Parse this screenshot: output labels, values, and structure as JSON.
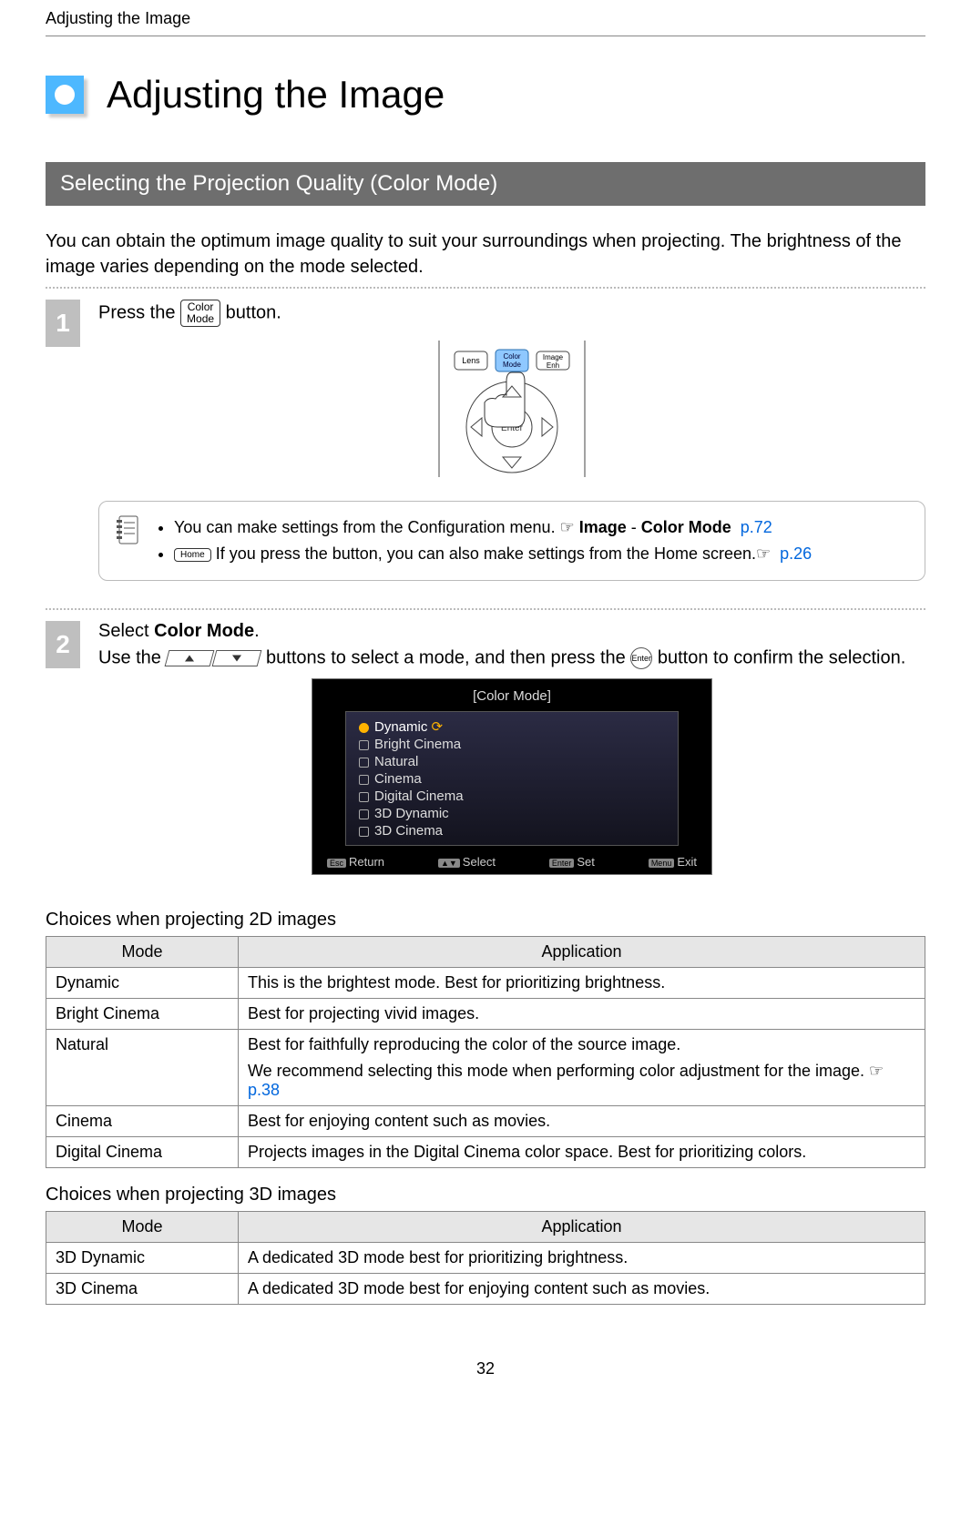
{
  "running_head": "Adjusting the Image",
  "title": "Adjusting the Image",
  "section_bar": "Selecting the Projection Quality (Color Mode)",
  "intro": "You can obtain the optimum image quality to suit your surroundings when projecting. The brightness of the image varies depending on the mode selected.",
  "step1": {
    "num": "1",
    "text_before": "Press the ",
    "btn": "Color\nMode",
    "text_after": " button."
  },
  "remote_labels": {
    "lens": "Lens",
    "color": "Color\nMode",
    "enh": "Image\nEnh",
    "enter": "Enter"
  },
  "note": {
    "line1_a": "You can make settings from the Configuration menu. ",
    "line1_b": "Image",
    "line1_c": " - ",
    "line1_d": "Color Mode",
    "line1_link": "p.72",
    "line2_btn": "Home",
    "line2_a": " If you press the button, you can also make settings from the Home screen.",
    "line2_link": "p.26"
  },
  "step2": {
    "num": "2",
    "title_a": "Select ",
    "title_b": "Color Mode",
    "title_c": ".",
    "body_a": "Use the ",
    "body_b": " buttons to select a mode, and then press the ",
    "enter": "Enter",
    "body_c": " button to confirm the selection."
  },
  "menushot": {
    "title": "[Color Mode]",
    "items": [
      "Dynamic",
      "Bright Cinema",
      "Natural",
      "Cinema",
      "Digital Cinema",
      "3D Dynamic",
      "3D Cinema"
    ],
    "selected_index": 0,
    "foot": {
      "return_k": "Esc",
      "return": "Return",
      "select_k": "▲▼",
      "select": "Select",
      "set_k": "Enter",
      "set": "Set",
      "exit_k": "Menu",
      "exit": "Exit"
    }
  },
  "table2d_caption": "Choices when projecting 2D images",
  "table_headers": {
    "mode": "Mode",
    "app": "Application"
  },
  "table2d": [
    {
      "mode": "Dynamic",
      "app": "This is the brightest mode. Best for prioritizing brightness."
    },
    {
      "mode": "Bright Cinema",
      "app": "Best for projecting vivid images."
    },
    {
      "mode": "Natural",
      "app_a": "Best for faithfully reproducing the color of the source image.",
      "app_b": "We recommend selecting this mode when performing color adjustment for the image.",
      "link": "p.38"
    },
    {
      "mode": "Cinema",
      "app": "Best for enjoying content such as movies."
    },
    {
      "mode": "Digital Cinema",
      "app": "Projects images in the Digital Cinema color space. Best for prioritizing colors."
    }
  ],
  "table3d_caption": "Choices when projecting 3D images",
  "table3d": [
    {
      "mode": "3D Dynamic",
      "app": "A dedicated 3D mode best for prioritizing brightness."
    },
    {
      "mode": "3D Cinema",
      "app": "A dedicated 3D mode best for enjoying content such as movies."
    }
  ],
  "page_number": "32"
}
